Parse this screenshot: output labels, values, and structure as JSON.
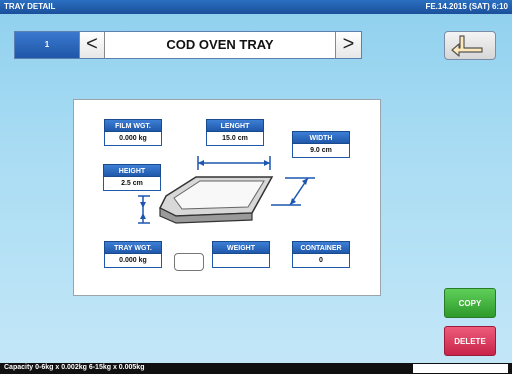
{
  "header": {
    "title": "TRAY DETAIL",
    "datetime": "FE.14.2015 (SAT)  6:10"
  },
  "nav": {
    "number": "1",
    "prev": "<",
    "next": ">",
    "title": "COD OVEN TRAY"
  },
  "fields": {
    "film_wgt": {
      "label": "FILM WGT.",
      "value": "0.000 kg"
    },
    "lenght": {
      "label": "LENGHT",
      "value": "15.0 cm"
    },
    "width": {
      "label": "WIDTH",
      "value": "9.0 cm"
    },
    "height": {
      "label": "HEIGHT",
      "value": "2.5 cm"
    },
    "tray_wgt": {
      "label": "TRAY WGT.",
      "value": "0.000 kg"
    },
    "weight": {
      "label": "WEIGHT",
      "value": ""
    },
    "container": {
      "label": "CONTAINER",
      "value": "0"
    }
  },
  "buttons": {
    "copy": "COPY",
    "delete": "DELETE"
  },
  "status": {
    "capacity": "Capacity 0-6kg x 0.002kg  6-15kg x 0.005kg"
  },
  "icons": {
    "return": "return-arrow-icon",
    "tray": "tray-icon"
  }
}
